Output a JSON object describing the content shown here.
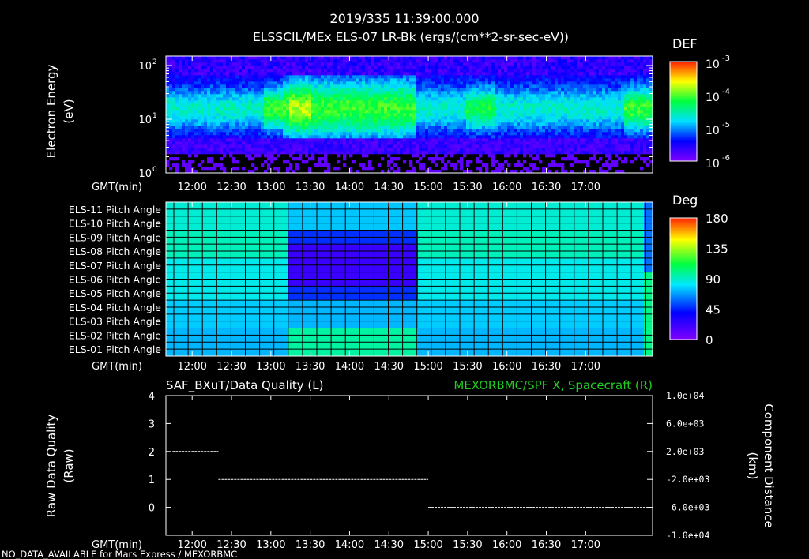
{
  "header": {
    "timestamp": "2019/335 11:39:00.000",
    "title": "ELSSCIL/MEx ELS-07 LR-Bk  (ergs/(cm**2-sr-sec-eV))"
  },
  "footer": {
    "note": "NO_DATA_AVAILABLE for Mars Express / MEXORBMC"
  },
  "chart_data": [
    {
      "type": "heatmap",
      "name": "spectrogram",
      "ylabel": [
        "Electron Energy",
        "(eV)"
      ],
      "y_scale": "log",
      "ylim": [
        1,
        150
      ],
      "y_ticks": [
        {
          "value": 1,
          "base": "10",
          "exp": "0"
        },
        {
          "value": 10,
          "base": "10",
          "exp": "1"
        },
        {
          "value": 100,
          "base": "10",
          "exp": "2"
        }
      ],
      "x_axis_label": "GMT(min)",
      "x_ticks": [
        "12:00",
        "12:30",
        "13:00",
        "13:30",
        "14:00",
        "14:30",
        "15:00",
        "15:30",
        "16:00",
        "16:30",
        "17:00"
      ],
      "colorbar": {
        "label": "DEF",
        "ticks": [
          {
            "base": "10",
            "exp": "-3"
          },
          {
            "base": "10",
            "exp": "-4"
          },
          {
            "base": "10",
            "exp": "-5"
          },
          {
            "base": "10",
            "exp": "-6"
          }
        ]
      }
    },
    {
      "type": "heatmap",
      "name": "pitch-angle",
      "rows": [
        "ELS-11 Pitch Angle",
        "ELS-10 Pitch Angle",
        "ELS-09 Pitch Angle",
        "ELS-08 Pitch Angle",
        "ELS-07 Pitch Angle",
        "ELS-06 Pitch Angle",
        "ELS-05 Pitch Angle",
        "ELS-04 Pitch Angle",
        "ELS-03 Pitch Angle",
        "ELS-02 Pitch Angle",
        "ELS-01 Pitch Angle"
      ],
      "x_axis_label": "GMT(min)",
      "x_ticks": [
        "12:00",
        "12:30",
        "13:00",
        "13:30",
        "14:00",
        "14:30",
        "15:00",
        "15:30",
        "16:00",
        "16:30",
        "17:00"
      ],
      "colorbar": {
        "label": "Deg",
        "range": [
          0,
          180
        ],
        "ticks": [
          "180",
          "135",
          "90",
          "45",
          "0"
        ]
      }
    },
    {
      "type": "line",
      "name": "data-quality",
      "title_left": "SAF_BXuT/Data Quality (L)",
      "title_right": "MEXORBMC/SPF X, Spacecraft (R)",
      "ylabel_left": [
        "Raw Data Quality",
        "(Raw)"
      ],
      "ylabel_right": [
        "Component Distance",
        "(km)"
      ],
      "ylim": [
        -1,
        4
      ],
      "y_ticks_left": [
        "4",
        "3",
        "2",
        "1",
        "0"
      ],
      "y_ticks_right": [
        "1.0e+04",
        "6.0e+03",
        "2.0e+03",
        "-2.0e+03",
        "-6.0e+03",
        "-1.0e+04"
      ],
      "x_axis_label": "GMT(min)",
      "x_ticks": [
        "12:00",
        "12:30",
        "13:00",
        "13:30",
        "14:00",
        "14:30",
        "15:00",
        "15:30",
        "16:00",
        "16:30",
        "17:00"
      ],
      "series": [
        {
          "segments": [
            {
              "from": "11:45",
              "to": "12:20",
              "value": 2
            },
            {
              "from": "12:20",
              "to": "15:00",
              "value": 1
            },
            {
              "from": "15:00",
              "to": "17:50",
              "value": 0
            }
          ]
        }
      ],
      "colors": {
        "left_title": "#ffffff",
        "right_title": "#22cc22"
      }
    }
  ]
}
